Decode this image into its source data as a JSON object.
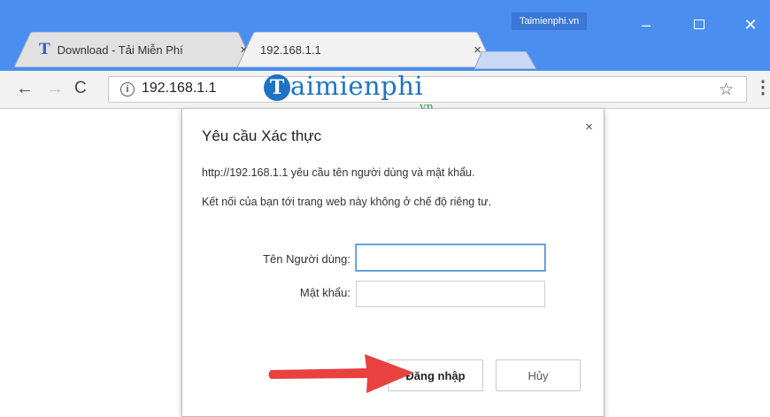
{
  "browser": {
    "tabs": [
      {
        "title": "Download - Tải Miễn Phí",
        "logo": "T",
        "close": "×",
        "active": false
      },
      {
        "title": "192.168.1.1",
        "close": "×",
        "active": true
      }
    ],
    "brand_label": "Taimienphi.vn",
    "window_controls": {
      "minimize": "–",
      "close": "✕"
    },
    "url": "192.168.1.1",
    "nav": {
      "back": "←",
      "forward": "→",
      "reload": "C"
    },
    "info_icon": "i",
    "star_icon": "☆",
    "menu_icon": "⋮"
  },
  "watermark": {
    "badge": "T",
    "text": "aimienphi",
    "suffix": ".vn"
  },
  "dialog": {
    "title": "Yêu cầu Xác thực",
    "close": "×",
    "message_1": "http://192.168.1.1 yêu cầu tên người dùng và mật khẩu.",
    "message_2": "Kết nối của bạn tới trang web này không ở chế độ riêng tư.",
    "username_label": "Tên Người dùng:",
    "password_label": "Mật khẩu:",
    "username_value": "",
    "password_value": "",
    "login_button": "Đăng nhập",
    "cancel_button": "Hủy"
  },
  "colors": {
    "titlebar": "#4a8ff0",
    "arrow": "#e8413f",
    "focus_border": "#4a90d9"
  }
}
